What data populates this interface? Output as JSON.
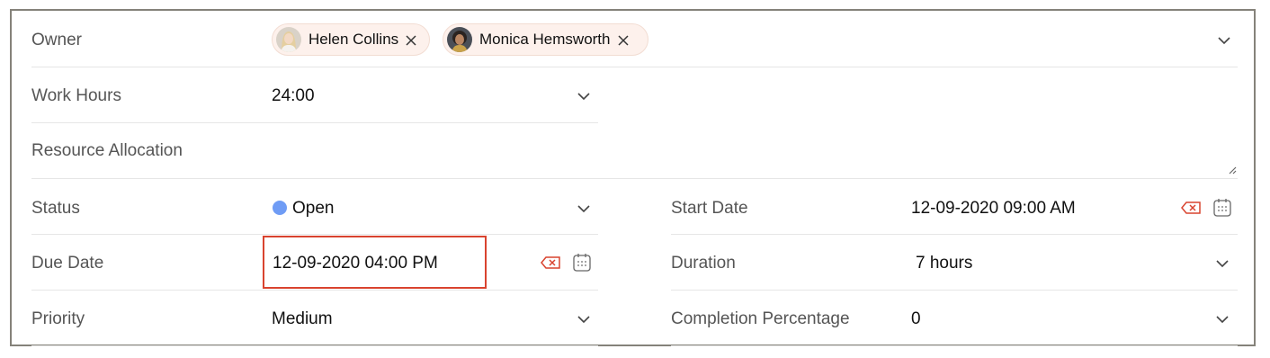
{
  "owner": {
    "label": "Owner",
    "users": [
      {
        "name": "Helen Collins"
      },
      {
        "name": "Monica Hemsworth"
      }
    ]
  },
  "work_hours": {
    "label": "Work Hours",
    "value": "24:00"
  },
  "resource_allocation": {
    "label": "Resource Allocation"
  },
  "status": {
    "label": "Status",
    "value": "Open",
    "dot_color": "#6f9cf5"
  },
  "due_date": {
    "label": "Due Date",
    "value": "12-09-2020 04:00 PM"
  },
  "priority": {
    "label": "Priority",
    "value": "Medium"
  },
  "start_date": {
    "label": "Start Date",
    "value": "12-09-2020 09:00 AM"
  },
  "duration": {
    "label": "Duration",
    "value": "7 hours"
  },
  "completion": {
    "label": "Completion Percentage",
    "value": "0"
  },
  "colors": {
    "highlight": "#d9432f",
    "clear_icon": "#d9432f",
    "chip_bg": "#fdf1ec"
  }
}
